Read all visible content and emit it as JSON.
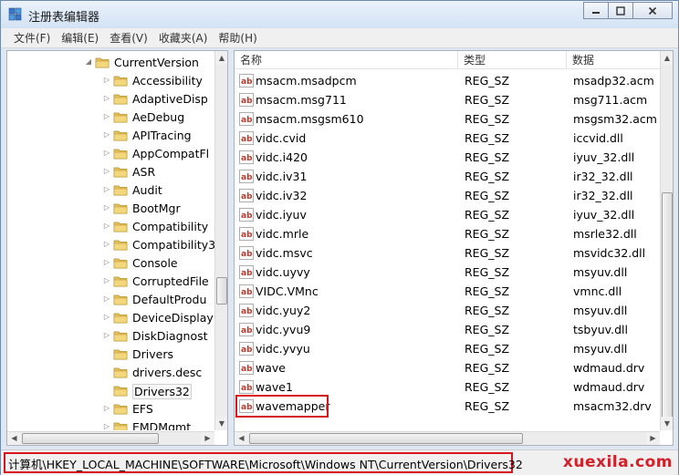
{
  "window": {
    "title": "注册表编辑器",
    "controls": {
      "minimize": "▭",
      "restore": "❐",
      "close": "✕"
    }
  },
  "menu": [
    "文件(F)",
    "编辑(E)",
    "查看(V)",
    "收藏夹(A)",
    "帮助(H)"
  ],
  "tree": {
    "items": [
      {
        "label": "CurrentVersion",
        "expanded": true,
        "level": 0
      },
      {
        "label": "Accessibility",
        "level": 1
      },
      {
        "label": "AdaptiveDisp",
        "level": 1
      },
      {
        "label": "AeDebug",
        "level": 1
      },
      {
        "label": "APITracing",
        "level": 1
      },
      {
        "label": "AppCompatFl",
        "level": 1
      },
      {
        "label": "ASR",
        "level": 1
      },
      {
        "label": "Audit",
        "level": 1
      },
      {
        "label": "BootMgr",
        "level": 1
      },
      {
        "label": "Compatibility",
        "level": 1
      },
      {
        "label": "Compatibility3",
        "level": 1
      },
      {
        "label": "Console",
        "level": 1
      },
      {
        "label": "CorruptedFile",
        "level": 1
      },
      {
        "label": "DefaultProdu",
        "level": 1
      },
      {
        "label": "DeviceDisplay",
        "level": 1
      },
      {
        "label": "DiskDiagnost",
        "level": 1
      },
      {
        "label": "Drivers",
        "level": 1,
        "noArrow": true
      },
      {
        "label": "drivers.desc",
        "level": 1,
        "noArrow": true
      },
      {
        "label": "Drivers32",
        "level": 1,
        "noArrow": true,
        "selected": true
      },
      {
        "label": "EFS",
        "level": 1
      },
      {
        "label": "EMDMgmt",
        "level": 1
      }
    ]
  },
  "list": {
    "columns": [
      "名称",
      "类型",
      "数据"
    ],
    "rows": [
      {
        "name": "msacm.msadpcm",
        "type": "REG_SZ",
        "data": "msadp32.acm"
      },
      {
        "name": "msacm.msg711",
        "type": "REG_SZ",
        "data": "msg711.acm"
      },
      {
        "name": "msacm.msgsm610",
        "type": "REG_SZ",
        "data": "msgsm32.acm"
      },
      {
        "name": "vidc.cvid",
        "type": "REG_SZ",
        "data": "iccvid.dll"
      },
      {
        "name": "vidc.i420",
        "type": "REG_SZ",
        "data": "iyuv_32.dll"
      },
      {
        "name": "vidc.iv31",
        "type": "REG_SZ",
        "data": "ir32_32.dll"
      },
      {
        "name": "vidc.iv32",
        "type": "REG_SZ",
        "data": "ir32_32.dll"
      },
      {
        "name": "vidc.iyuv",
        "type": "REG_SZ",
        "data": "iyuv_32.dll"
      },
      {
        "name": "vidc.mrle",
        "type": "REG_SZ",
        "data": "msrle32.dll"
      },
      {
        "name": "vidc.msvc",
        "type": "REG_SZ",
        "data": "msvidc32.dll"
      },
      {
        "name": "vidc.uyvy",
        "type": "REG_SZ",
        "data": "msyuv.dll"
      },
      {
        "name": "VIDC.VMnc",
        "type": "REG_SZ",
        "data": "vmnc.dll"
      },
      {
        "name": "vidc.yuy2",
        "type": "REG_SZ",
        "data": "msyuv.dll"
      },
      {
        "name": "vidc.yvu9",
        "type": "REG_SZ",
        "data": "tsbyuv.dll"
      },
      {
        "name": "vidc.yvyu",
        "type": "REG_SZ",
        "data": "msyuv.dll"
      },
      {
        "name": "wave",
        "type": "REG_SZ",
        "data": "wdmaud.drv"
      },
      {
        "name": "wave1",
        "type": "REG_SZ",
        "data": "wdmaud.drv"
      },
      {
        "name": "wavemapper",
        "type": "REG_SZ",
        "data": "msacm32.drv",
        "highlighted": true
      }
    ]
  },
  "status": {
    "path": "计算机\\HKEY_LOCAL_MACHINE\\SOFTWARE\\Microsoft\\Windows NT\\CurrentVersion\\Drivers32"
  },
  "watermark": "xuexila.com",
  "colors": {
    "highlight": "#d8141c",
    "folder": "#e8c25a",
    "ab_icon_red": "#c0392b"
  }
}
